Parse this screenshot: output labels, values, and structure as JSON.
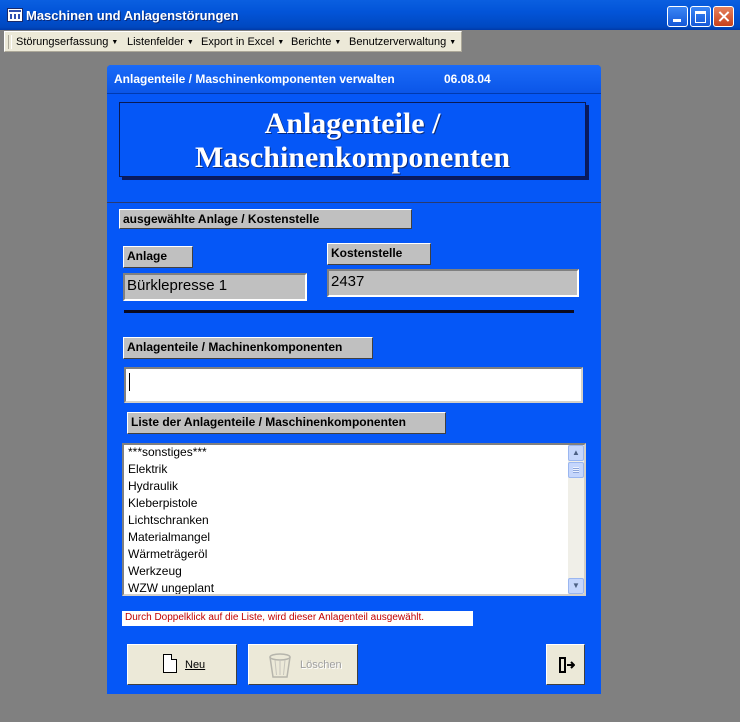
{
  "window": {
    "title": "Maschinen und Anlagenstörungen"
  },
  "menu": {
    "items": [
      {
        "label": "Störungserfassung"
      },
      {
        "label": "Listenfelder"
      },
      {
        "label": "Export in Excel"
      },
      {
        "label": "Berichte"
      },
      {
        "label": "Benutzerverwaltung"
      }
    ]
  },
  "form": {
    "title": "Anlagenteile / Maschinenkomponenten verwalten",
    "date": "06.08.04",
    "header_line1": "Anlagenteile /",
    "header_line2": "Maschinenkomponenten",
    "section_label": "ausgewählte Anlage / Kostenstelle",
    "anlage_label": "Anlage",
    "anlage_value": "Bürklepresse 1",
    "kostenstelle_label": "Kostenstelle",
    "kostenstelle_value": "2437",
    "komponenten_label": "Anlagenteile / Machinenkomponenten",
    "komponenten_value": "",
    "list_label": "Liste der Anlagenteile / Maschinenkomponenten",
    "list_items": [
      "***sonstiges***",
      "Elektrik",
      "Hydraulik",
      "Kleberpistole",
      "Lichtschranken",
      "Materialmangel",
      "Wärmeträgeröl",
      "Werkzeug",
      "WZW ungeplant"
    ],
    "hint": "Durch Doppelklick auf die Liste, wird dieser Anlagenteil ausgewählt.",
    "new_button": "Neu",
    "delete_button": "Löschen"
  },
  "icons": {
    "new": "new-document-icon",
    "delete": "recycle-bin-icon",
    "exit": "exit-door-icon"
  },
  "colors": {
    "form_background": "#0557F7",
    "hint_text": "#C00000"
  }
}
